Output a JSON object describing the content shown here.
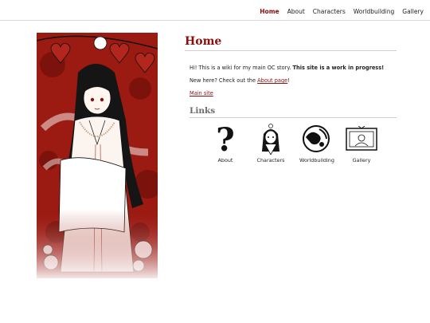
{
  "nav": {
    "items": [
      {
        "label": "Home",
        "active": true
      },
      {
        "label": "About"
      },
      {
        "label": "Characters"
      },
      {
        "label": "Worldbuilding"
      },
      {
        "label": "Gallery"
      }
    ]
  },
  "main": {
    "title": "Home",
    "intro_text": "Hi! This is a wiki for my main OC story. ",
    "intro_bold": "This site is a work in progress!",
    "newhere_text": "New here? Check out the ",
    "newhere_link": "About page",
    "newhere_suffix": "!",
    "main_site_link": "Main site",
    "links_heading": "Links",
    "links": [
      {
        "label": "About",
        "icon": "question-mark-icon"
      },
      {
        "label": "Characters",
        "icon": "character-portrait-icon"
      },
      {
        "label": "Worldbuilding",
        "icon": "globe-swirl-icon"
      },
      {
        "label": "Gallery",
        "icon": "framed-picture-icon"
      }
    ]
  },
  "hero_image": {
    "icon": "character-illustration",
    "accent": "#9b1a12"
  },
  "colors": {
    "accent": "#8a0f0f",
    "heading_gray": "#6c6c6c",
    "divider": "#cfcfcf"
  }
}
